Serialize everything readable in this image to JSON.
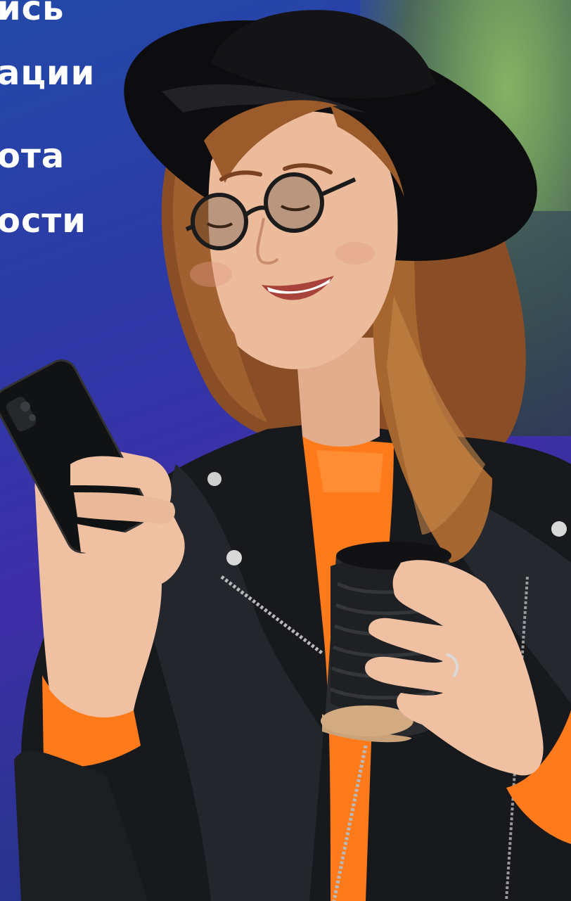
{
  "headline": {
    "lines": [
      "ись",
      "ации",
      "ота",
      "ости"
    ]
  },
  "colors": {
    "background_blue": "#2c3aa6",
    "jacket": "#16181c",
    "sweater": "#ff7a1a",
    "hat": "#0d0d0f",
    "hair": "#9a5a2c",
    "skin": "#e8b89a"
  },
  "icons": [
    "phone-image",
    "coffee-cup-image",
    "glasses-image",
    "hat-image"
  ]
}
